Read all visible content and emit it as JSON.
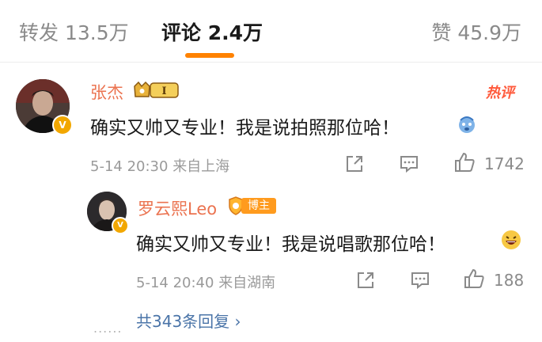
{
  "tabs": {
    "reposts": "转发 13.5万",
    "comments": "评论 2.4万",
    "likes": "赞 45.9万",
    "active": "comments"
  },
  "comment": {
    "username": "张杰",
    "fan_level": "I",
    "hot_badge": "热评",
    "text": "确实又帅又专业！我是说拍照那位哈！",
    "emoji": "dizzy-face-emoji",
    "timestamp": "5-14 20:30",
    "location": "来自上海",
    "like_count": "1742"
  },
  "reply": {
    "username": "罗云熙Leo",
    "badge_label": "博主",
    "text": "确实又帅又专业！我是说唱歌那位哈！",
    "emoji": "grinning-face-emoji",
    "timestamp": "5-14 20:40",
    "location": "来自湖南",
    "like_count": "188"
  },
  "more_dots": "......",
  "more_replies": "共343条回复 ›",
  "colors": {
    "accent": "#ff8200",
    "username": "#eb7350",
    "link": "#4a74a8",
    "hot": "#ff5a3c",
    "verified": "#f2a700"
  }
}
